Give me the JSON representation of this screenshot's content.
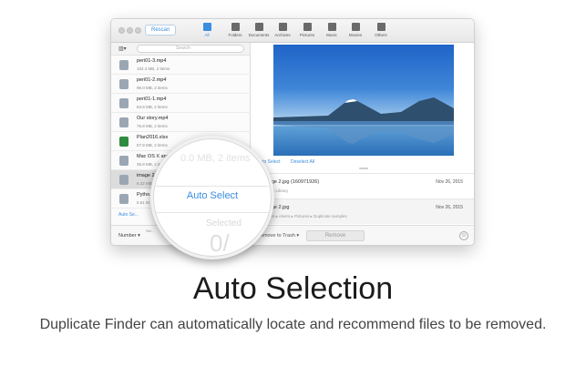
{
  "toolbar": {
    "rescan_label": "Rescan",
    "categories": [
      {
        "label": "All",
        "icon": "all-icon",
        "selected": true
      },
      {
        "label": "Folders",
        "icon": "folder-icon"
      },
      {
        "label": "Documents",
        "icon": "document-icon"
      },
      {
        "label": "Archives",
        "icon": "archive-icon"
      },
      {
        "label": "Pictures",
        "icon": "picture-icon"
      },
      {
        "label": "Music",
        "icon": "music-icon"
      },
      {
        "label": "Movies",
        "icon": "movie-icon"
      },
      {
        "label": "Others",
        "icon": "others-icon"
      }
    ]
  },
  "sidebar": {
    "search_placeholder": "Search",
    "items": [
      {
        "name": "peri01-3.mp4",
        "meta": "104.4 MB, 2 items"
      },
      {
        "name": "peri01-2.mp4",
        "meta": "96.0 MB, 2 items"
      },
      {
        "name": "peri01-1.mp4",
        "meta": "84.8 MB, 2 items"
      },
      {
        "name": "Our story.mp4",
        "meta": "76.8 MB, 2 items"
      },
      {
        "name": "Plan2016.xlsx",
        "meta": "57.8 MB, 2 items"
      },
      {
        "name": "Mac OS X and ...",
        "meta": "35.8 MB, 2 items"
      },
      {
        "name": "image 2.j...",
        "meta": "6.32 MB"
      },
      {
        "name": "Pytho...",
        "meta": "5.51 M..."
      }
    ],
    "auto_select_label": "Auto Se..."
  },
  "preview": {
    "auto_select": "Auto Select",
    "deselect_all": "Deselect All"
  },
  "duplicates": [
    {
      "name": "image 2.jpg  (160971926)",
      "sub": "...otos Library",
      "date": "Nov 26, 2015"
    },
    {
      "name": "image 2.jpg",
      "sub": "...hers ▸ elvers ▸ Pictures ▸ Duplicate samples",
      "date": "Nov 26, 2015"
    }
  ],
  "bottombar": {
    "sort_label": "Number ▾",
    "selected_label": "Sel...",
    "move_to_trash": "Remove to Trash ▾",
    "remove_label": "Remove"
  },
  "magnifier": {
    "faint_top": "0.0 MB, 2 items",
    "auto_select": "Auto Select",
    "faint_selected": "Selected",
    "faint_count": "0/"
  },
  "headline": "Auto Selection",
  "subtitle": "Duplicate Finder can automatically locate and recommend files to be removed.",
  "colors": {
    "accent": "#3b8de0"
  }
}
